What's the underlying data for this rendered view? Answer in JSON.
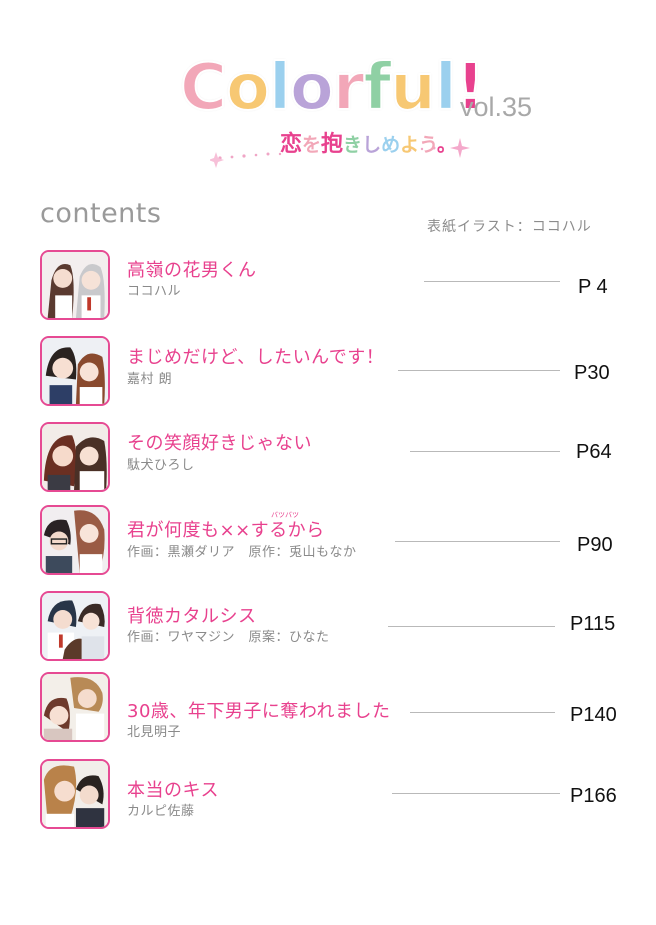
{
  "magazine": {
    "logo_word": "Colorful!",
    "volume": "vol.35",
    "tagline": "恋を抱きしめよう。",
    "logo_colors": [
      "#f2a7b8",
      "#f7c873",
      "#9bd0ee",
      "#b9a3d8",
      "#f2a7b8",
      "#8fd0a4",
      "#f7c873",
      "#9bd0ee",
      "#e8418e"
    ],
    "tagline_colors": [
      "#e8418e",
      "#f2a7b8",
      "#e8418e",
      "#8fd0a4",
      "#b9a3d8",
      "#9bd0ee",
      "#f7c873",
      "#f2a7b8",
      "#e8418e"
    ]
  },
  "contents_heading": "contents",
  "cover_credit": "表紙イラスト：ココハル",
  "accent_color": "#e8418e",
  "entries": [
    {
      "title": "高嶺の花男くん",
      "author": "ココハル",
      "page": "P 4"
    },
    {
      "title": "まじめだけど、したいんです！",
      "author": "嘉村 朗",
      "page": "P30"
    },
    {
      "title": "その笑顔好きじゃない",
      "author": "駄犬ひろし",
      "page": "P64"
    },
    {
      "title": "君が何度も××するから",
      "title_ruby": "バツバツ",
      "author": "作画：黒瀬ダリア　原作：兎山もなか",
      "page": "P90"
    },
    {
      "title": "背徳カタルシス",
      "author": "作画：ワヤマジン　原案：ひなた",
      "page": "P115"
    },
    {
      "title": "30歳、年下男子に奪われました",
      "author": "北見明子",
      "page": "P140"
    },
    {
      "title": "本当のキス",
      "author": "カルピ佐藤",
      "page": "P166"
    }
  ]
}
